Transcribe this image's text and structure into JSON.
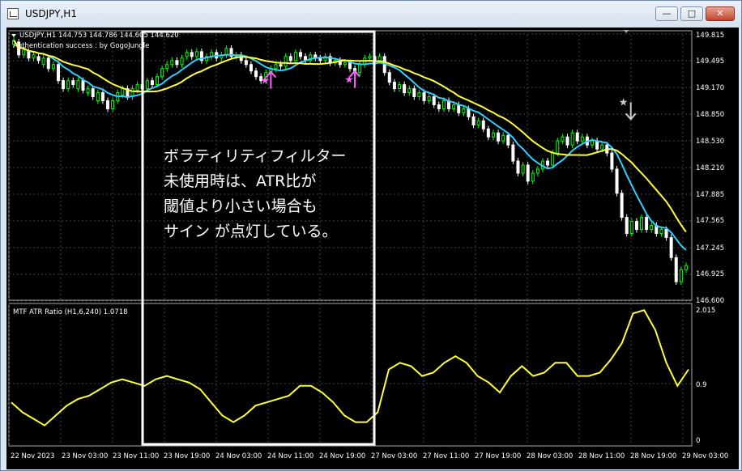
{
  "window": {
    "title": "USDJPY,H1",
    "minimize_label": "—",
    "maximize_label": "□",
    "close_label": "✕",
    "icon": "chart-window-icon"
  },
  "main_panel": {
    "header": "USDJPY,H1  144.753 144.786 144.605 144.620",
    "status": "Authentication success : by GogoJungle",
    "price_labels": [
      "149.815",
      "149.495",
      "149.170",
      "148.850",
      "148.530",
      "148.210",
      "147.885",
      "147.565",
      "147.245",
      "146.925",
      "146.600"
    ],
    "signals": [
      {
        "type": "buy",
        "price": 149.34,
        "candle": 52
      },
      {
        "type": "buy",
        "price": 149.35,
        "candle": 69
      },
      {
        "type": "sell",
        "price": 148.75,
        "candle": 124
      }
    ]
  },
  "sub_panel": {
    "header": "MTF ATR Ratio  (H1,6,240) 1.0718",
    "scale_labels": [
      "2.015",
      "0.9",
      "0"
    ]
  },
  "time_labels": [
    "22 Nov 2023",
    "23 Nov 03:00",
    "23 Nov 11:00",
    "23 Nov 19:00",
    "24 Nov 03:00",
    "24 Nov 11:00",
    "24 Nov 19:00",
    "27 Nov 03:00",
    "27 Nov 11:00",
    "27 Nov 19:00",
    "28 Nov 03:00",
    "28 Nov 11:00",
    "28 Nov 19:00",
    "29 Nov 03:00"
  ],
  "annotation": {
    "lines": [
      "ボラティリティフィルター",
      "未使用時は、ATR比が",
      "閾値より小さい場合も",
      "サイン が点灯している。"
    ]
  },
  "chart_data": {
    "type": "candlestick",
    "symbol": "USDJPY",
    "timeframe": "H1",
    "ylim": [
      146.6,
      149.9
    ],
    "candles": [
      {
        "o": 149.75,
        "c": 149.8
      },
      {
        "o": 149.78,
        "c": 149.62
      },
      {
        "o": 149.62,
        "c": 149.68
      },
      {
        "o": 149.66,
        "c": 149.58
      },
      {
        "o": 149.58,
        "c": 149.62
      },
      {
        "o": 149.6,
        "c": 149.55
      },
      {
        "o": 149.5,
        "c": 149.58
      },
      {
        "o": 149.58,
        "c": 149.45
      },
      {
        "o": 149.45,
        "c": 149.5
      },
      {
        "o": 149.5,
        "c": 149.3
      },
      {
        "o": 149.3,
        "c": 149.2
      },
      {
        "o": 149.2,
        "c": 149.3
      },
      {
        "o": 149.3,
        "c": 149.25
      },
      {
        "o": 149.2,
        "c": 149.3
      },
      {
        "o": 149.3,
        "c": 149.18
      },
      {
        "o": 149.15,
        "c": 149.2
      },
      {
        "o": 149.2,
        "c": 149.1
      },
      {
        "o": 149.05,
        "c": 149.15
      },
      {
        "o": 149.15,
        "c": 149.05
      },
      {
        "o": 149.05,
        "c": 148.95
      },
      {
        "o": 148.95,
        "c": 149.05
      },
      {
        "o": 149.05,
        "c": 149.15
      },
      {
        "o": 149.12,
        "c": 149.2
      },
      {
        "o": 149.2,
        "c": 149.1
      },
      {
        "o": 149.1,
        "c": 149.2
      },
      {
        "o": 149.18,
        "c": 149.25
      },
      {
        "o": 149.25,
        "c": 149.2
      },
      {
        "o": 149.2,
        "c": 149.3
      },
      {
        "o": 149.3,
        "c": 149.25
      },
      {
        "o": 149.25,
        "c": 149.35
      },
      {
        "o": 149.35,
        "c": 149.45
      },
      {
        "o": 149.45,
        "c": 149.5
      },
      {
        "o": 149.5,
        "c": 149.55
      },
      {
        "o": 149.55,
        "c": 149.5
      },
      {
        "o": 149.5,
        "c": 149.58
      },
      {
        "o": 149.6,
        "c": 149.65
      },
      {
        "o": 149.65,
        "c": 149.6
      },
      {
        "o": 149.6,
        "c": 149.66
      },
      {
        "o": 149.66,
        "c": 149.55
      },
      {
        "o": 149.55,
        "c": 149.6
      },
      {
        "o": 149.6,
        "c": 149.65
      },
      {
        "o": 149.65,
        "c": 149.58
      },
      {
        "o": 149.58,
        "c": 149.62
      },
      {
        "o": 149.62,
        "c": 149.7
      },
      {
        "o": 149.7,
        "c": 149.6
      },
      {
        "o": 149.6,
        "c": 149.62
      },
      {
        "o": 149.62,
        "c": 149.55
      },
      {
        "o": 149.55,
        "c": 149.5
      },
      {
        "o": 149.5,
        "c": 149.42
      },
      {
        "o": 149.42,
        "c": 149.35
      },
      {
        "o": 149.35,
        "c": 149.3
      },
      {
        "o": 149.3,
        "c": 149.4
      },
      {
        "o": 149.4,
        "c": 149.45
      },
      {
        "o": 149.45,
        "c": 149.5
      },
      {
        "o": 149.5,
        "c": 149.48
      },
      {
        "o": 149.48,
        "c": 149.6
      },
      {
        "o": 149.6,
        "c": 149.55
      },
      {
        "o": 149.55,
        "c": 149.65
      },
      {
        "o": 149.65,
        "c": 149.6
      },
      {
        "o": 149.6,
        "c": 149.55
      },
      {
        "o": 149.55,
        "c": 149.62
      },
      {
        "o": 149.62,
        "c": 149.58
      },
      {
        "o": 149.58,
        "c": 149.55
      },
      {
        "o": 149.55,
        "c": 149.6
      },
      {
        "o": 149.6,
        "c": 149.52
      },
      {
        "o": 149.52,
        "c": 149.55
      },
      {
        "o": 149.55,
        "c": 149.5
      },
      {
        "o": 149.5,
        "c": 149.52
      },
      {
        "o": 149.52,
        "c": 149.45
      },
      {
        "o": 149.45,
        "c": 149.4
      },
      {
        "o": 149.4,
        "c": 149.5
      },
      {
        "o": 149.5,
        "c": 149.58
      },
      {
        "o": 149.58,
        "c": 149.6
      },
      {
        "o": 149.6,
        "c": 149.55
      },
      {
        "o": 149.55,
        "c": 149.6
      },
      {
        "o": 149.6,
        "c": 149.4
      },
      {
        "o": 149.4,
        "c": 149.28
      },
      {
        "o": 149.28,
        "c": 149.2
      },
      {
        "o": 149.2,
        "c": 149.25
      },
      {
        "o": 149.25,
        "c": 149.15
      },
      {
        "o": 149.15,
        "c": 149.2
      },
      {
        "o": 149.2,
        "c": 149.1
      },
      {
        "o": 149.1,
        "c": 149.15
      },
      {
        "o": 149.15,
        "c": 149.05
      },
      {
        "o": 149.05,
        "c": 149.1
      },
      {
        "o": 149.1,
        "c": 149.0
      },
      {
        "o": 149.0,
        "c": 148.95
      },
      {
        "o": 148.95,
        "c": 149.05
      },
      {
        "o": 149.05,
        "c": 148.95
      },
      {
        "o": 148.95,
        "c": 149.0
      },
      {
        "o": 149.0,
        "c": 148.9
      },
      {
        "o": 148.9,
        "c": 148.95
      },
      {
        "o": 148.95,
        "c": 148.85
      },
      {
        "o": 148.85,
        "c": 148.75
      },
      {
        "o": 148.75,
        "c": 148.8
      },
      {
        "o": 148.8,
        "c": 148.7
      },
      {
        "o": 148.7,
        "c": 148.6
      },
      {
        "o": 148.6,
        "c": 148.65
      },
      {
        "o": 148.65,
        "c": 148.55
      },
      {
        "o": 148.55,
        "c": 148.62
      },
      {
        "o": 148.62,
        "c": 148.5
      },
      {
        "o": 148.5,
        "c": 148.3
      },
      {
        "o": 148.3,
        "c": 148.15
      },
      {
        "o": 148.15,
        "c": 148.25
      },
      {
        "o": 148.25,
        "c": 148.05
      },
      {
        "o": 148.05,
        "c": 148.15
      },
      {
        "o": 148.15,
        "c": 148.2
      },
      {
        "o": 148.2,
        "c": 148.3
      },
      {
        "o": 148.3,
        "c": 148.25
      },
      {
        "o": 148.25,
        "c": 148.4
      },
      {
        "o": 148.4,
        "c": 148.55
      },
      {
        "o": 148.55,
        "c": 148.6
      },
      {
        "o": 148.6,
        "c": 148.5
      },
      {
        "o": 148.5,
        "c": 148.65
      },
      {
        "o": 148.65,
        "c": 148.55
      },
      {
        "o": 148.55,
        "c": 148.6
      },
      {
        "o": 148.6,
        "c": 148.5
      },
      {
        "o": 148.5,
        "c": 148.55
      },
      {
        "o": 148.55,
        "c": 148.45
      },
      {
        "o": 148.45,
        "c": 148.5
      },
      {
        "o": 148.5,
        "c": 148.4
      },
      {
        "o": 148.4,
        "c": 148.2
      },
      {
        "o": 148.2,
        "c": 147.9
      },
      {
        "o": 147.9,
        "c": 147.6
      },
      {
        "o": 147.6,
        "c": 147.4
      },
      {
        "o": 147.4,
        "c": 147.55
      },
      {
        "o": 147.55,
        "c": 147.45
      },
      {
        "o": 147.45,
        "c": 147.6
      },
      {
        "o": 147.6,
        "c": 147.45
      },
      {
        "o": 147.45,
        "c": 147.5
      },
      {
        "o": 147.5,
        "c": 147.4
      },
      {
        "o": 147.4,
        "c": 147.45
      },
      {
        "o": 147.45,
        "c": 147.35
      },
      {
        "o": 147.35,
        "c": 147.1
      },
      {
        "o": 147.1,
        "c": 146.8
      },
      {
        "o": 146.8,
        "c": 146.95
      },
      {
        "o": 146.95,
        "c": 147.0
      }
    ],
    "ma_fast_color": "#33ccff",
    "ma_slow_color": "#ffff33",
    "bull_color": "#00ff00",
    "bear_color": "#ffffff",
    "atr_ratio": [
      0.6,
      0.45,
      0.35,
      0.25,
      0.4,
      0.55,
      0.65,
      0.7,
      0.8,
      0.9,
      0.95,
      0.9,
      0.85,
      0.95,
      1.0,
      0.95,
      0.9,
      0.8,
      0.6,
      0.4,
      0.3,
      0.4,
      0.55,
      0.6,
      0.65,
      0.7,
      0.85,
      0.85,
      0.75,
      0.6,
      0.4,
      0.3,
      0.3,
      0.45,
      1.1,
      1.2,
      1.15,
      1.0,
      1.05,
      1.2,
      1.3,
      1.2,
      1.0,
      0.9,
      0.75,
      1.0,
      1.15,
      1.0,
      1.05,
      1.2,
      1.2,
      1.0,
      1.0,
      1.05,
      1.25,
      1.5,
      1.95,
      2.0,
      1.7,
      1.2,
      0.85,
      1.1
    ],
    "atr_color": "#ffff33"
  }
}
